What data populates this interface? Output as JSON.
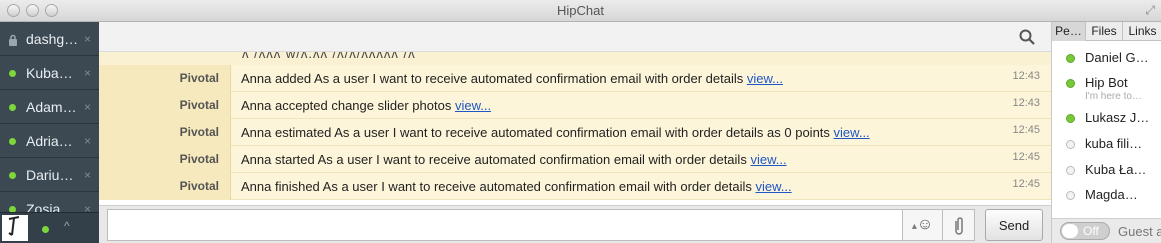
{
  "window": {
    "title": "HipChat"
  },
  "sidebar": {
    "rooms": [
      {
        "name": "dashg…",
        "locked": true
      },
      {
        "name": "Kuba…",
        "locked": false
      },
      {
        "name": "Adam…",
        "locked": false
      },
      {
        "name": "Adria…",
        "locked": false
      },
      {
        "name": "Dariu…",
        "locked": false
      },
      {
        "name": "Zosia",
        "locked": false
      }
    ],
    "close_glyph": "×",
    "collapse_glyph": "^"
  },
  "messages": [
    {
      "from": "Pivotal",
      "text": "Anna added As a user I want to receive automated confirmation email with order details",
      "link": "view...",
      "time": "12:43"
    },
    {
      "from": "Pivotal",
      "text": "Anna accepted change slider photos",
      "link": "view...",
      "time": "12:43"
    },
    {
      "from": "Pivotal",
      "text": "Anna estimated As a user I want to receive automated confirmation email with order details as 0 points",
      "link": "view...",
      "time": "12:45"
    },
    {
      "from": "Pivotal",
      "text": "Anna started As a user I want to receive automated confirmation email with order details",
      "link": "view...",
      "time": "12:45"
    },
    {
      "from": "Pivotal",
      "text": "Anna finished As a user I want to receive automated confirmation email with order details",
      "link": "view...",
      "time": "12:45"
    }
  ],
  "composer": {
    "input_value": "",
    "send_label": "Send",
    "emoji_glyph": "☺"
  },
  "rightpanel": {
    "tabs": [
      "Pe…",
      "Files",
      "Links"
    ],
    "active_tab": 0,
    "people": [
      {
        "name": "Daniel G…",
        "status": "",
        "online": true
      },
      {
        "name": "Hip Bot",
        "status": "I'm here to…",
        "online": true
      },
      {
        "name": "Lukasz J…",
        "status": "",
        "online": true
      },
      {
        "name": "kuba fili…",
        "status": "",
        "online": false
      },
      {
        "name": "Kuba Ła…",
        "status": "",
        "online": false
      },
      {
        "name": "Magda…",
        "status": "",
        "online": false
      }
    ],
    "guest_toggle": {
      "label": "Off",
      "text": "Guest a"
    }
  },
  "colors": {
    "sidebar": "#3c4852",
    "online": "#7dd63a",
    "link": "#1f56c5",
    "message_bg": "#fdf5d9"
  }
}
